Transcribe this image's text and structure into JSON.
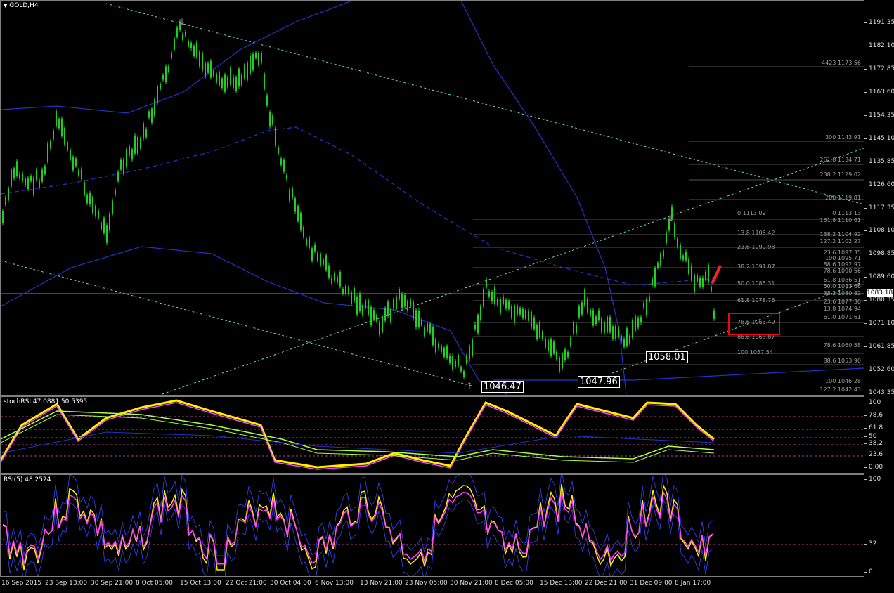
{
  "symbol_label": "GOLD,H4",
  "stoch_label": "stochRSI 47.0881 50.5395",
  "rsi_label": "RSI(5) 48.2524",
  "current_price": "1083.18",
  "price_ticks": [
    "1191.35",
    "1182.10",
    "1172.85",
    "1163.60",
    "1154.35",
    "1145.10",
    "1135.85",
    "1126.60",
    "1117.35",
    "1108.10",
    "1098.85",
    "1089.60",
    "1080.35",
    "1071.10",
    "1061.85",
    "1052.60",
    "1043.35"
  ],
  "stoch_ticks": [
    "100",
    "78.6",
    "61.8",
    "50",
    "38.2",
    "23.6",
    "0.00"
  ],
  "rsi_ticks": [
    "100",
    "32",
    "0"
  ],
  "time_ticks": [
    "16 Sep 2015",
    "23 Sep 13:00",
    "30 Sep 21:00",
    "8 Oct 05:00",
    "15 Oct 13:00",
    "22 Oct 21:00",
    "30 Oct 04:00",
    "6 Nov 13:00",
    "13 Nov 21:00",
    "23 Nov 05:00",
    "30 Nov 21:00",
    "8 Dec 05:00",
    "15 Dec 13:00",
    "22 Dec 21:00",
    "31 Dec 09:00",
    "8 Jan 17:00"
  ],
  "pivots": [
    "1046.47",
    "1047.96",
    "1058.01"
  ],
  "fib_labels_left": [
    "0 1113.09",
    "13.8 1105.42",
    "23.6 1099.98",
    "38.2 1091.87",
    "50.0 1085.31",
    "61.8 1078.76",
    "78.6 1063.49",
    "88.6 1063.87",
    "100 1057.54"
  ],
  "fib_labels_right": [
    "4423 1173.56",
    "300 1143.91",
    "261.8 1134.71",
    "238.2 1129.02",
    "200 1119.81",
    "0 1113.13",
    "161.8 1110.61",
    "138.2 1104.92",
    "127.2 1102.27",
    "23.6 1097.35",
    "100 1095.71",
    "88.6 1092.97",
    "78.6 1090.56",
    "61.8 1086.51",
    "50.0 1083.66",
    "38.2 1080.82",
    "23.6 1077.30",
    "13.8 1074.94",
    "61.0 1071.61",
    "78.6 1060.58",
    "88.6 1053.90",
    "100 1046.28",
    "127.2 1042.43"
  ],
  "colors": {
    "candles": "#1fd01f",
    "channel": "#2233cc",
    "fib": "#9a9a9a",
    "trend": "#66ddaa",
    "stoch_main": "#ffee00",
    "stoch_signal": "#ff44ff",
    "rsi_main": "#ffee00",
    "rsi_signal": "#ff44ff",
    "highlight": "#ff0000"
  },
  "icons": {
    "dropdown": "triangle-down-icon",
    "pane_scroll": "triangle-down-icon"
  }
}
